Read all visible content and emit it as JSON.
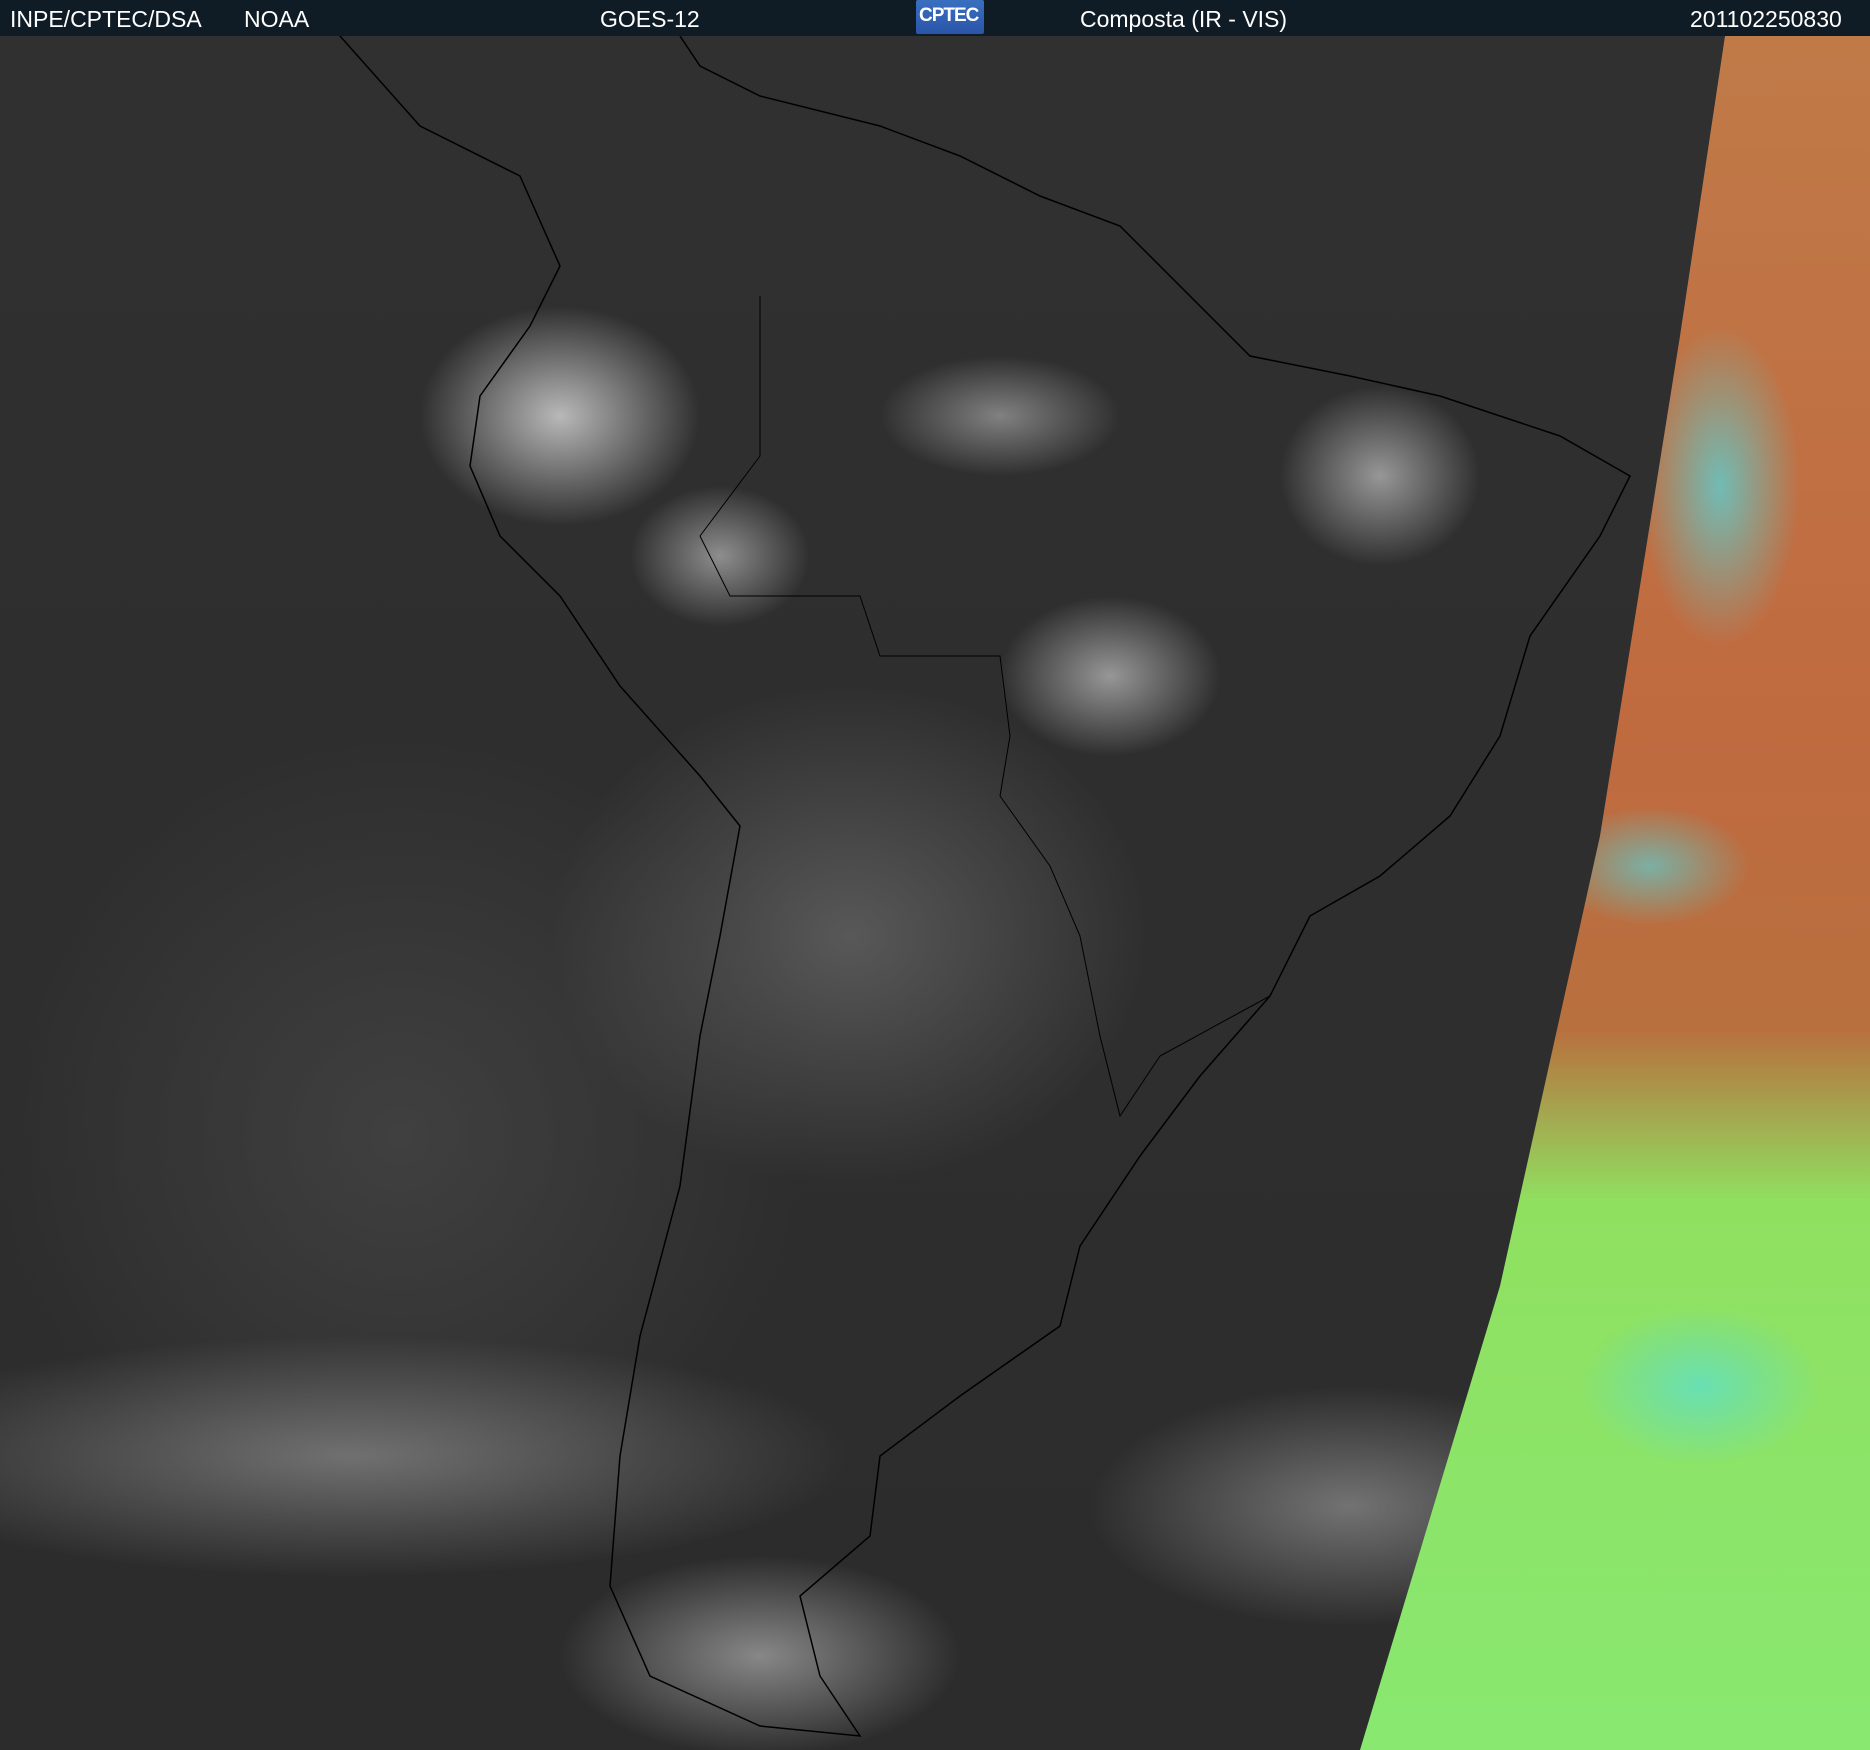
{
  "header": {
    "source": "INPE/CPTEC/DSA",
    "agency": "NOAA",
    "satellite": "GOES-12",
    "logo_text": "CPTEC",
    "product": "Composta (IR - VIS)",
    "timestamp": "201102250830"
  },
  "colors": {
    "header_bg": "#0f1c26",
    "ocean": "#2e2e2e",
    "strip_top": "#c07a48",
    "strip_bottom": "#88e870"
  }
}
